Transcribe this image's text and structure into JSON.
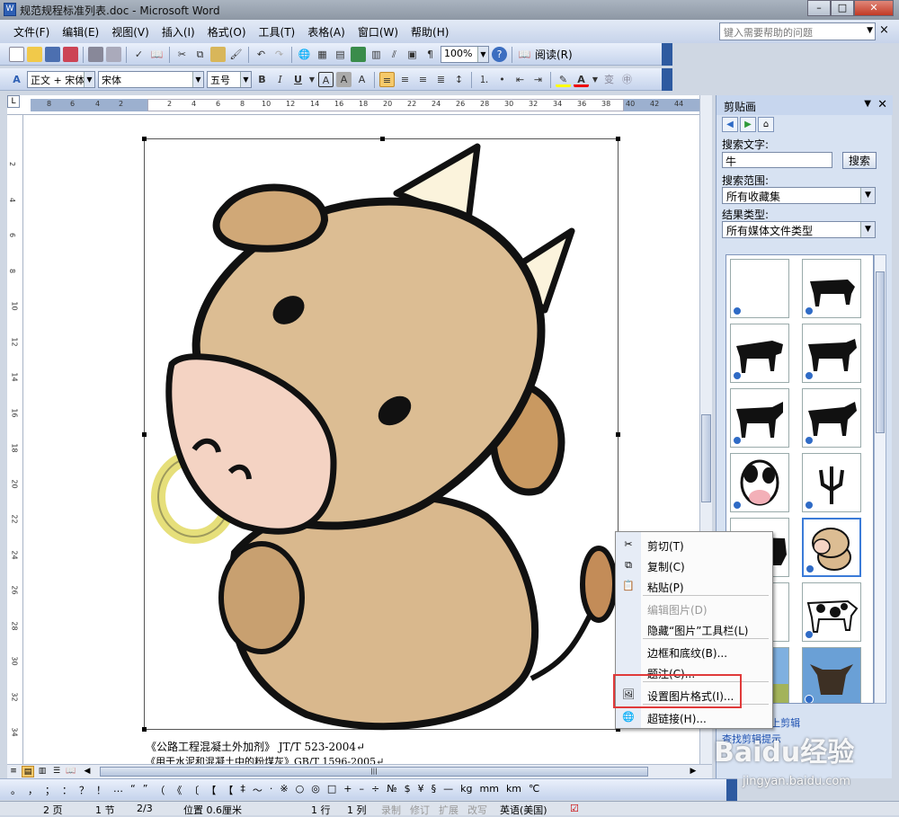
{
  "window": {
    "title": "规范规程标准列表.doc - Microsoft Word",
    "min": "–",
    "max": "□",
    "close": "✕"
  },
  "menubar": {
    "items": [
      "文件(F)",
      "编辑(E)",
      "视图(V)",
      "插入(I)",
      "格式(O)",
      "工具(T)",
      "表格(A)",
      "窗口(W)",
      "帮助(H)"
    ],
    "help_placeholder": "键入需要帮助的问题",
    "close": "×"
  },
  "toolbar_standard": {
    "zoom": "100%",
    "read_label": "阅读(R)"
  },
  "toolbar_format": {
    "style": "正文 + 宋体",
    "font": "宋体",
    "size": "五号",
    "bold": "B",
    "italic": "I",
    "underline": "U",
    "char_border": "A",
    "char_shade": "A",
    "font_color": "A",
    "wen": "变"
  },
  "ruler": {
    "numbers": [
      "8",
      "6",
      "4",
      "2",
      "2",
      "4",
      "6",
      "8",
      "10",
      "12",
      "14",
      "16",
      "18",
      "20",
      "22",
      "24",
      "26",
      "28",
      "30",
      "32",
      "34",
      "36",
      "38",
      "40",
      "42",
      "44"
    ],
    "corner": "L"
  },
  "vruler": {
    "numbers": [
      "2",
      "4",
      "6",
      "8",
      "10",
      "12",
      "14",
      "16",
      "18",
      "20",
      "22",
      "24",
      "26",
      "28",
      "30",
      "32",
      "34"
    ]
  },
  "document": {
    "line1": "《公路工程混凝土外加剂》 JT/T 523-2004↵",
    "line2": "《用于水泥和混凝土中的粉煤灰》GB/T 1596-2005↵"
  },
  "context_menu": {
    "items": [
      {
        "icon": "cut-icon",
        "label": "剪切(T)",
        "disabled": false
      },
      {
        "icon": "copy-icon",
        "label": "复制(C)",
        "disabled": false
      },
      {
        "icon": "paste-icon",
        "label": "粘贴(P)",
        "disabled": false
      },
      {
        "icon": "",
        "label": "编辑图片(D)",
        "disabled": true
      },
      {
        "icon": "",
        "label": "隐藏“图片”工具栏(L)",
        "disabled": false
      },
      {
        "icon": "",
        "label": "边框和底纹(B)...",
        "disabled": false
      },
      {
        "icon": "",
        "label": "题注(C)...",
        "disabled": false
      },
      {
        "icon": "format-picture-icon",
        "label": "设置图片格式(I)...",
        "disabled": false
      },
      {
        "icon": "hyperlink-icon",
        "label": "超链接(H)...",
        "disabled": false
      }
    ]
  },
  "taskpane": {
    "title": "剪贴画",
    "search_label": "搜索文字:",
    "search_value": "牛",
    "search_button": "搜索",
    "scope_label": "搜索范围:",
    "scope_value": "所有收藏集",
    "type_label": "结果类型:",
    "type_value": "所有媒体文件类型",
    "link1": "在Office网上剪辑",
    "link2": "查找剪辑提示"
  },
  "symbols": [
    "。",
    "，",
    "；",
    "：",
    "？",
    "！",
    "…",
    "“",
    "”",
    "（",
    "《",
    "〔",
    "【",
    "【",
    "‡",
    "～",
    "·",
    "※",
    "○",
    "◎",
    "□",
    "+",
    "–",
    "÷",
    "№",
    "$",
    "¥",
    "§",
    "—",
    "kg",
    "mm",
    "km",
    "℃"
  ],
  "statusbar": {
    "page": "2 页",
    "section": "1 节",
    "pages": "2/3",
    "position": "位置 0.6厘米",
    "line": "1 行",
    "col": "1 列",
    "rec": "录制",
    "trk": "修订",
    "ext": "扩展",
    "ovr": "改写",
    "lang": "英语(美国)"
  },
  "watermark": {
    "brand": "Baidu经验",
    "url": "jingyan.baidu.com"
  }
}
